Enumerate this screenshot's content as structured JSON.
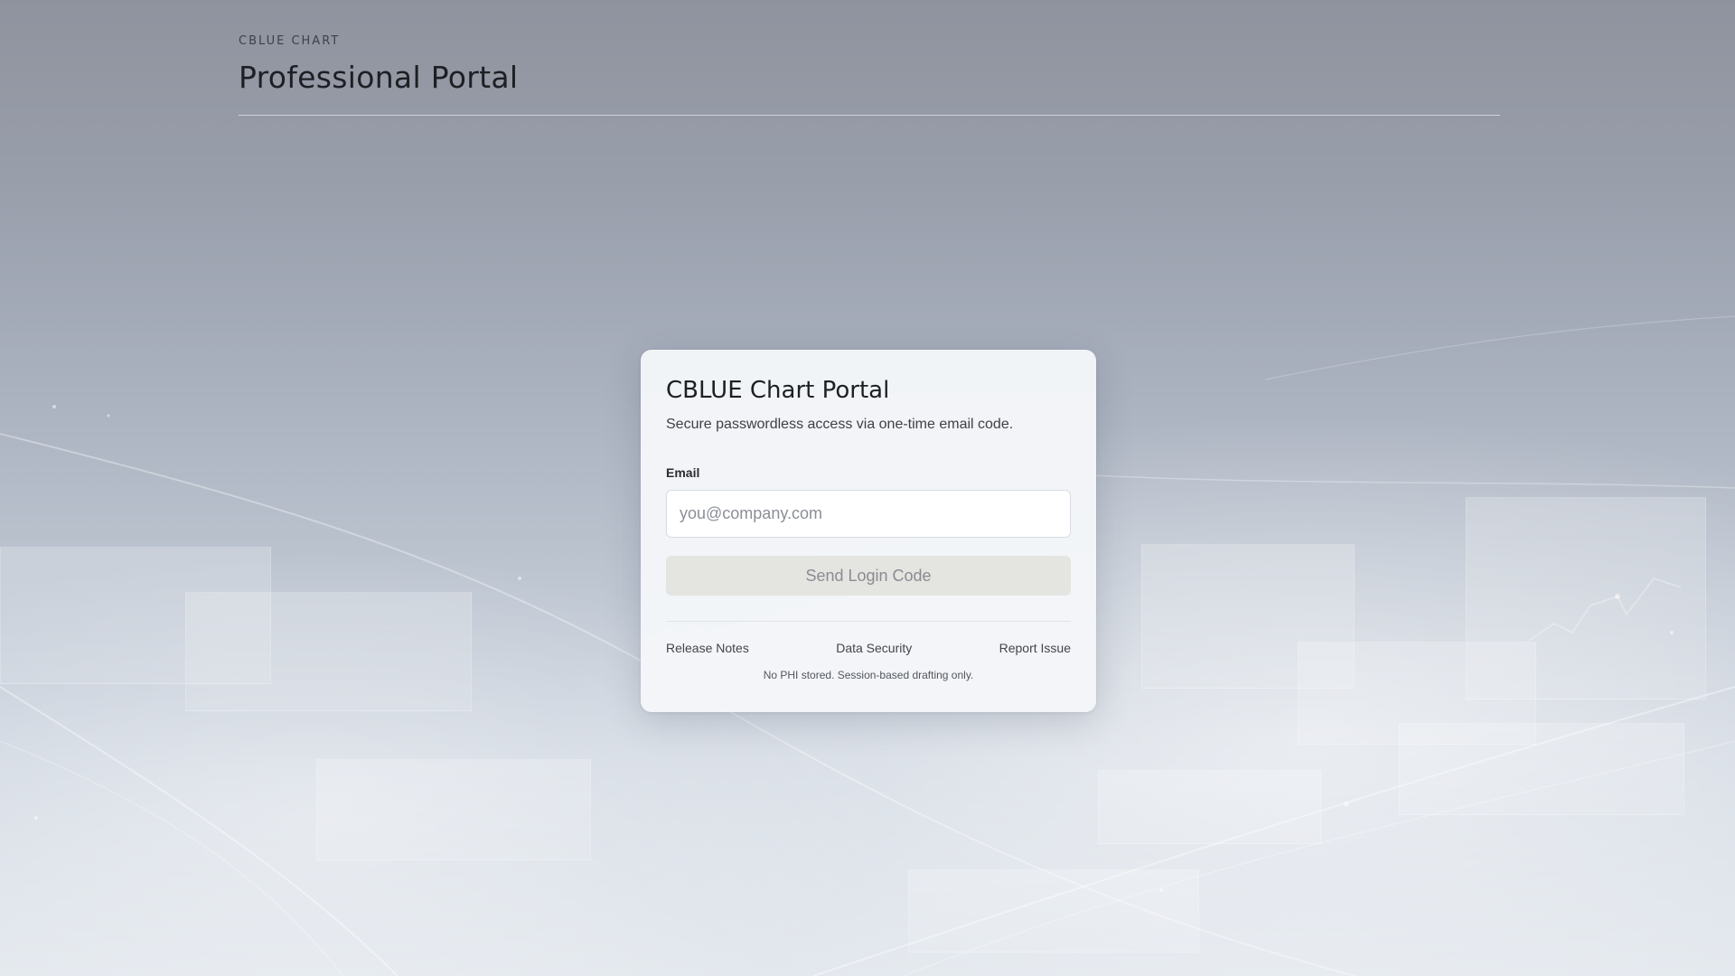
{
  "header": {
    "eyebrow": "CBLUE CHART",
    "title": "Professional Portal"
  },
  "login_card": {
    "title": "CBLUE Chart Portal",
    "subtitle": "Secure passwordless access via one-time email code.",
    "email_label": "Email",
    "email_placeholder": "you@company.com",
    "email_value": "",
    "submit_label": "Send Login Code",
    "links": [
      {
        "label": "Release Notes"
      },
      {
        "label": "Data Security"
      },
      {
        "label": "Report Issue"
      }
    ],
    "note": "No PHI stored. Session-based drafting only."
  },
  "theme": {
    "background_top": "#8f939e",
    "background_bottom": "#e3e8ee",
    "card_background": "#f4f6f9",
    "button_disabled_background": "#e4e4e1",
    "button_disabled_text": "#8a8c90",
    "title_text": "#1d1f24"
  }
}
